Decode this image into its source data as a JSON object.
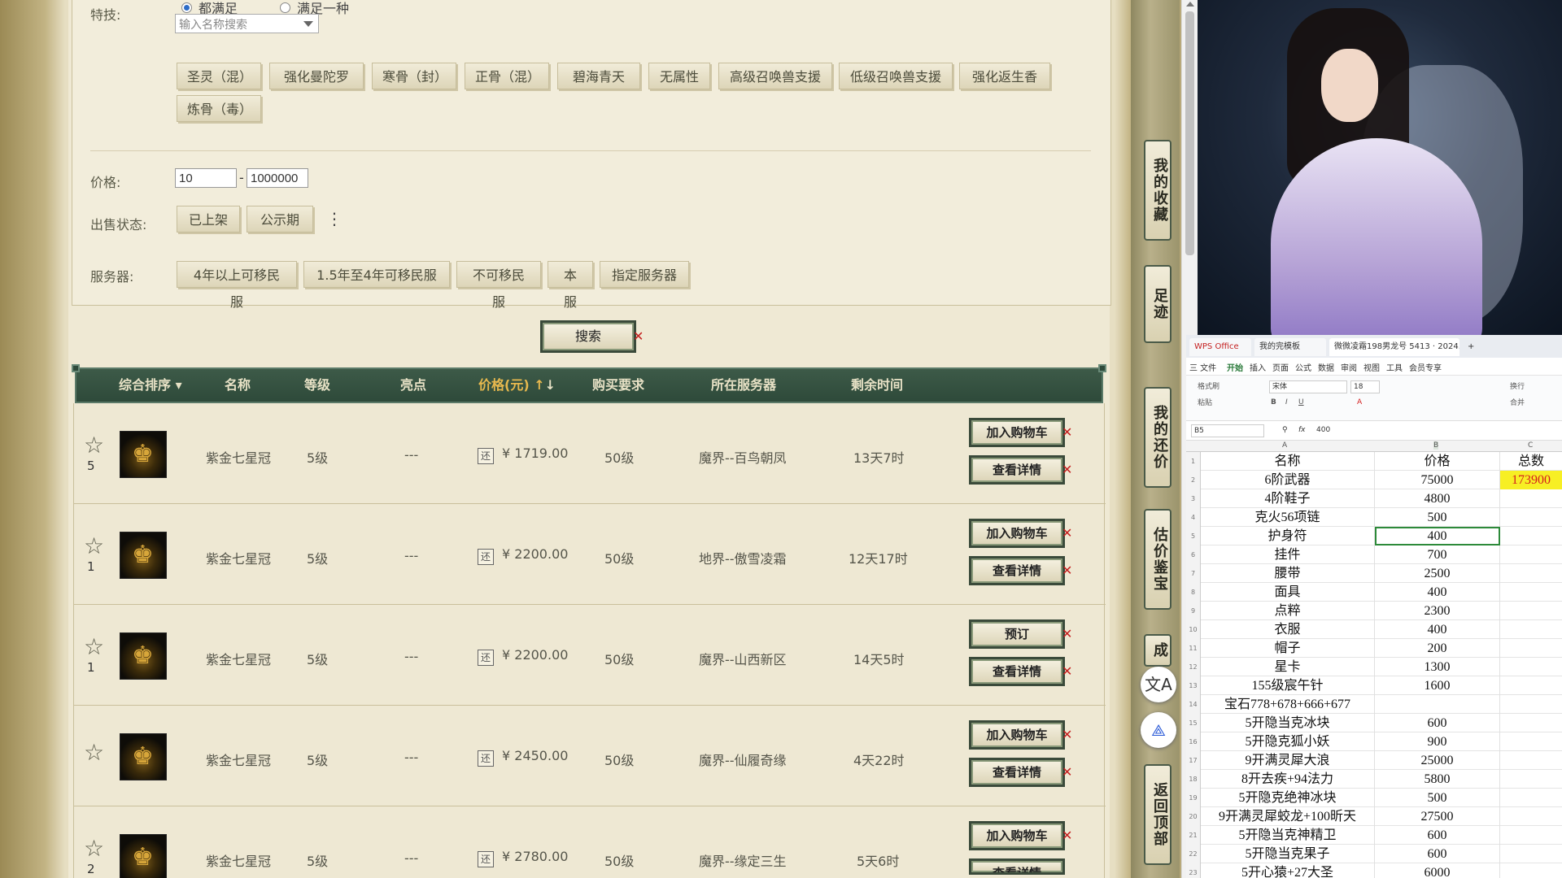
{
  "filter": {
    "skills_label": "特技:",
    "radio_all": "都满足",
    "radio_any": "满足一种",
    "skill_search_placeholder": "输入名称搜索",
    "skill_chips": [
      "圣灵（混）",
      "强化曼陀罗",
      "寒骨（封）",
      "正骨（混）",
      "碧海青天",
      "无属性",
      "高级召唤兽支援",
      "低级召唤兽支援",
      "强化返生香",
      "炼骨（毒）"
    ],
    "price_label": "价格:",
    "price_min": "10",
    "price_max": "1000000",
    "price_sep": "-",
    "status_label": "出售状态:",
    "status_chips": [
      "已上架",
      "公示期"
    ],
    "more_icon": "⋮",
    "server_label": "服务器:",
    "server_chips": [
      "4年以上可移民服",
      "1.5年至4年可移民服",
      "不可移民服",
      "本服",
      "指定服务器"
    ],
    "search_button": "搜索"
  },
  "table": {
    "headers": {
      "sort": "综合排序",
      "name": "名称",
      "level": "等级",
      "highlight": "亮点",
      "price": "价格(元)",
      "requirement": "购买要求",
      "server": "所在服务器",
      "time_left": "剩余时间"
    },
    "bargain_icon": "还",
    "star_icon": "☆",
    "rows": [
      {
        "favorites": "5",
        "name": "紫金七星冠",
        "level": "5级",
        "highlight": "---",
        "price": "¥ 1719.00",
        "requirement": "50级",
        "server": "魔界--百鸟朝凤",
        "time_left": "13天7时",
        "action1": "加入购物车",
        "action2": "查看详情"
      },
      {
        "favorites": "1",
        "name": "紫金七星冠",
        "level": "5级",
        "highlight": "---",
        "price": "¥ 2200.00",
        "requirement": "50级",
        "server": "地界--傲雪凌霜",
        "time_left": "12天17时",
        "action1": "加入购物车",
        "action2": "查看详情"
      },
      {
        "favorites": "1",
        "name": "紫金七星冠",
        "level": "5级",
        "highlight": "---",
        "price": "¥ 2200.00",
        "requirement": "50级",
        "server": "魔界--山西新区",
        "time_left": "14天5时",
        "action1": "预订",
        "action2": "查看详情"
      },
      {
        "favorites": "",
        "name": "紫金七星冠",
        "level": "5级",
        "highlight": "---",
        "price": "¥ 2450.00",
        "requirement": "50级",
        "server": "魔界--仙履奇缘",
        "time_left": "4天22时",
        "action1": "加入购物车",
        "action2": "查看详情"
      },
      {
        "favorites": "2",
        "name": "紫金七星冠",
        "level": "5级",
        "highlight": "---",
        "price": "¥ 2780.00",
        "requirement": "50级",
        "server": "魔界--缘定三生",
        "time_left": "5天6时",
        "action1": "加入购物车",
        "action2": "查看详情"
      }
    ]
  },
  "sidenav": {
    "favorites": "我的收藏",
    "footprints": "足迹",
    "my_bargains": "我的还价",
    "appraisal": "估价鉴宝",
    "deals": "成",
    "back_to_top": "返回顶部",
    "translate_icon": "文A",
    "share_icon": "⟁"
  },
  "wps": {
    "tabs": [
      "WPS Office",
      "我的完模板",
      "微微凌霜198男龙号 5413 · 2024..."
    ],
    "new_tab": "+",
    "menu": [
      "三 文件",
      "开始",
      "插入",
      "页面",
      "公式",
      "数据",
      "审阅",
      "视图",
      "工具",
      "会员专享"
    ],
    "active_menu": "开始",
    "toolbar": {
      "format_painter": "格式刷",
      "paste": "粘贴",
      "font": "宋体",
      "font_size": "18",
      "wrap": "换行",
      "merge": "合并"
    },
    "cell_ref": "B5",
    "fx": "fx",
    "formula_value": "400",
    "columns": [
      "A",
      "B",
      "C"
    ],
    "sheet_rows": [
      {
        "n": "1",
        "a": "名称",
        "b": "价格",
        "c": "总数"
      },
      {
        "n": "2",
        "a": "6阶武器",
        "b": "75000",
        "c": "173900"
      },
      {
        "n": "3",
        "a": "4阶鞋子",
        "b": "4800",
        "c": ""
      },
      {
        "n": "4",
        "a": "克火56项链",
        "b": "500",
        "c": ""
      },
      {
        "n": "5",
        "a": "护身符",
        "b": "400",
        "c": ""
      },
      {
        "n": "6",
        "a": "挂件",
        "b": "700",
        "c": ""
      },
      {
        "n": "7",
        "a": "腰带",
        "b": "2500",
        "c": ""
      },
      {
        "n": "8",
        "a": "面具",
        "b": "400",
        "c": ""
      },
      {
        "n": "9",
        "a": "点粹",
        "b": "2300",
        "c": ""
      },
      {
        "n": "10",
        "a": "衣服",
        "b": "400",
        "c": ""
      },
      {
        "n": "11",
        "a": "帽子",
        "b": "200",
        "c": ""
      },
      {
        "n": "12",
        "a": "星卡",
        "b": "1300",
        "c": ""
      },
      {
        "n": "13",
        "a": "155级宸午针",
        "b": "1600",
        "c": ""
      },
      {
        "n": "14",
        "a": "宝石778+678+666+677",
        "b": "",
        "c": ""
      },
      {
        "n": "15",
        "a": "5开隐当克冰块",
        "b": "600",
        "c": ""
      },
      {
        "n": "16",
        "a": "5开隐克狐小妖",
        "b": "900",
        "c": ""
      },
      {
        "n": "17",
        "a": "9开满灵犀大浪",
        "b": "25000",
        "c": ""
      },
      {
        "n": "18",
        "a": "8开去疾+94法力",
        "b": "5800",
        "c": ""
      },
      {
        "n": "19",
        "a": "5开隐克绝神冰块",
        "b": "500",
        "c": ""
      },
      {
        "n": "20",
        "a": "9开满灵犀蛟龙+100昕天",
        "b": "27500",
        "c": ""
      },
      {
        "n": "21",
        "a": "5开隐当克神精卫",
        "b": "600",
        "c": ""
      },
      {
        "n": "22",
        "a": "5开隐当克果子",
        "b": "600",
        "c": ""
      },
      {
        "n": "23",
        "a": "5开心猿+27大圣",
        "b": "6000",
        "c": ""
      }
    ]
  }
}
